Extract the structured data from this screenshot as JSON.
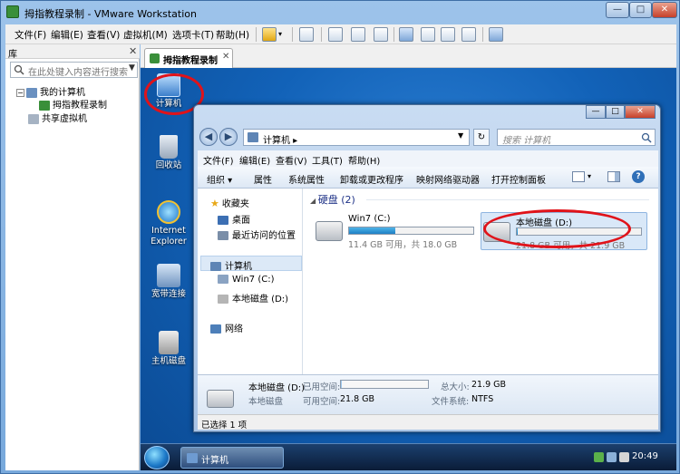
{
  "vmware": {
    "title": "拇指教程录制 - VMware Workstation",
    "menus": [
      "文件(F)",
      "编辑(E)",
      "查看(V)",
      "虚拟机(M)",
      "选项卡(T)",
      "帮助(H)"
    ],
    "library": {
      "title": "库",
      "search_placeholder": "在此处键入内容进行搜索",
      "tree": {
        "my_computer": "我的计算机",
        "vm": "拇指教程录制",
        "shared": "共享虚拟机"
      }
    },
    "tab_label": "拇指教程录制"
  },
  "desktop": {
    "icons": {
      "computer": "计算机",
      "recycle": "回收站",
      "ie_1": "Internet",
      "ie_2": "Explorer",
      "remote": "宽带连接",
      "shortcut": "主机磁盘"
    }
  },
  "explorer": {
    "address_text": "计算机 ▸",
    "search_placeholder": "搜索 计算机",
    "menus": [
      "文件(F)",
      "编辑(E)",
      "查看(V)",
      "工具(T)",
      "帮助(H)"
    ],
    "commands": [
      "组织 ▾",
      "属性",
      "系统属性",
      "卸载或更改程序",
      "映射网络驱动器",
      "打开控制面板"
    ],
    "nav": {
      "favorites": "收藏夹",
      "desktop": "桌面",
      "recent": "最近访问的位置",
      "computer": "计算机",
      "drive_c": "Win7 (C:)",
      "drive_d": "本地磁盘 (D:)",
      "network": "网络"
    },
    "group_header": "硬盘 (2)",
    "drives": [
      {
        "name": "Win7 (C:)",
        "free_text": "11.4 GB 可用，共 18.0 GB",
        "used_fraction": 0.37
      },
      {
        "name": "本地磁盘 (D:)",
        "free_text": "21.8 GB 可用，共 21.9 GB",
        "used_fraction": 0.005
      }
    ],
    "details": {
      "name": "本地磁盘 (D:)",
      "type": "本地磁盘",
      "used_label": "已用空间:",
      "free_label": "可用空间:",
      "free_value": "21.8 GB",
      "total_label": "总大小:",
      "total_value": "21.9 GB",
      "fs_label": "文件系统:",
      "fs_value": "NTFS",
      "used_fraction": 0.005
    },
    "status": "已选择 1 项"
  },
  "taskbar": {
    "button_label": "计算机",
    "clock": "20:49"
  },
  "colors": {
    "annotation_ring": "#e0131a",
    "desktop_blue": "#1262b8"
  }
}
